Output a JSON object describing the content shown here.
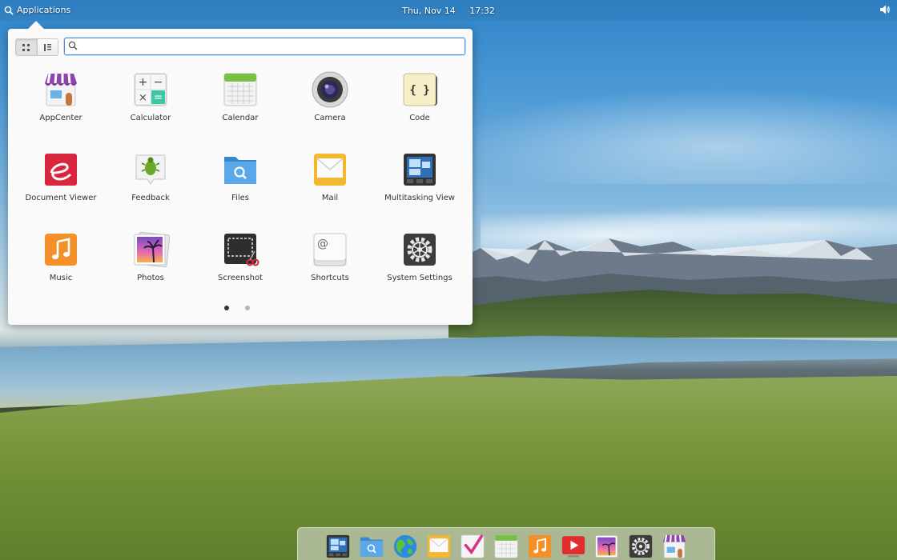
{
  "top_panel": {
    "applications_label": "Applications",
    "date": "Thu, Nov 14",
    "time": "17:32"
  },
  "launcher": {
    "search": {
      "value": "",
      "placeholder": ""
    },
    "view_modes": [
      "grid-view-icon",
      "category-view-icon"
    ],
    "apps": [
      {
        "label": "AppCenter",
        "icon": "appcenter-icon"
      },
      {
        "label": "Calculator",
        "icon": "calculator-icon"
      },
      {
        "label": "Calendar",
        "icon": "calendar-icon"
      },
      {
        "label": "Camera",
        "icon": "camera-icon"
      },
      {
        "label": "Code",
        "icon": "code-icon"
      },
      {
        "label": "Document Viewer",
        "icon": "document-viewer-icon"
      },
      {
        "label": "Feedback",
        "icon": "feedback-icon"
      },
      {
        "label": "Files",
        "icon": "files-icon"
      },
      {
        "label": "Mail",
        "icon": "mail-icon"
      },
      {
        "label": "Multitasking View",
        "icon": "multitasking-view-icon"
      },
      {
        "label": "Music",
        "icon": "music-icon"
      },
      {
        "label": "Photos",
        "icon": "photos-icon"
      },
      {
        "label": "Screenshot",
        "icon": "screenshot-icon"
      },
      {
        "label": "Shortcuts",
        "icon": "shortcuts-icon"
      },
      {
        "label": "System Settings",
        "icon": "system-settings-icon"
      }
    ],
    "pages": {
      "count": 2,
      "current": 1
    }
  },
  "dock": {
    "items": [
      "multitasking-view-icon",
      "files-icon",
      "web-browser-icon",
      "mail-icon",
      "tasks-icon",
      "calendar-icon",
      "music-icon",
      "videos-icon",
      "photos-icon",
      "system-settings-icon",
      "appcenter-icon"
    ]
  },
  "colors": {
    "accent": "#4a90d9",
    "launcher_bg": "#fafafa"
  }
}
